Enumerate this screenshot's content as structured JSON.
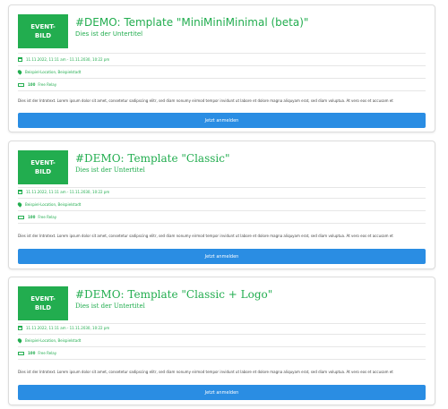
{
  "events": [
    {
      "thumb_line1": "EVENT-",
      "thumb_line2": "BILD",
      "title": "#DEMO: Template \"MiniMiniMinimal (beta)\"",
      "subtitle": "Dies ist der Untertitel",
      "date": "11.11.2022, 11:11 am - 11.11.2030, 10:22 pm",
      "location": "Beispiel-Location, Beispielstadt",
      "price_bold": "100",
      "price_label": "Free Relay",
      "intro": "Dies ist der Introtext. Lorem ipsum dolor sit amet, consetetur sadipscing elitr, sed diam nonumy eirmod tempor invidunt ut labore et dolore magna aliquyam erat, sed diam voluptua. At vero eos et accusam et",
      "button": "Jetzt anmelden"
    },
    {
      "thumb_line1": "EVENT-",
      "thumb_line2": "BILD",
      "title": "#DEMO: Template \"Classic\"",
      "subtitle": "Dies ist der Untertitel",
      "date": "11.11.2022, 11:11 am - 11.11.2030, 10:22 pm",
      "location": "Beispiel-Location, Beispielstadt",
      "price_bold": "100",
      "price_label": "Free Relay",
      "intro": "Dies ist der Introtext. Lorem ipsum dolor sit amet, consetetur sadipscing elitr, sed diam nonumy eirmod tempor invidunt ut labore et dolore magna aliquyam erat, sed diam voluptua. At vero eos et accusam et",
      "button": "Jetzt anmelden"
    },
    {
      "thumb_line1": "EVENT-",
      "thumb_line2": "BILD",
      "title": "#DEMO: Template \"Classic + Logo\"",
      "subtitle": "Dies ist der Untertitel",
      "date": "11.11.2022, 11:11 am - 11.11.2030, 10:22 pm",
      "location": "Beispiel-Location, Beispielstadt",
      "price_bold": "100",
      "price_label": "Free Relay",
      "intro": "Dies ist der Introtext. Lorem ipsum dolor sit amet, consetetur sadipscing elitr, sed diam nonumy eirmod tempor invidunt ut labore et dolore magna aliquyam erat, sed diam voluptua. At vero eos et accusam et",
      "button": "Jetzt anmelden"
    }
  ],
  "colors": {
    "accent": "#22ad4f",
    "button": "#2a8de3"
  },
  "icons": {
    "date": "calendar-icon",
    "location": "map-pin-icon",
    "price": "ticket-icon"
  }
}
